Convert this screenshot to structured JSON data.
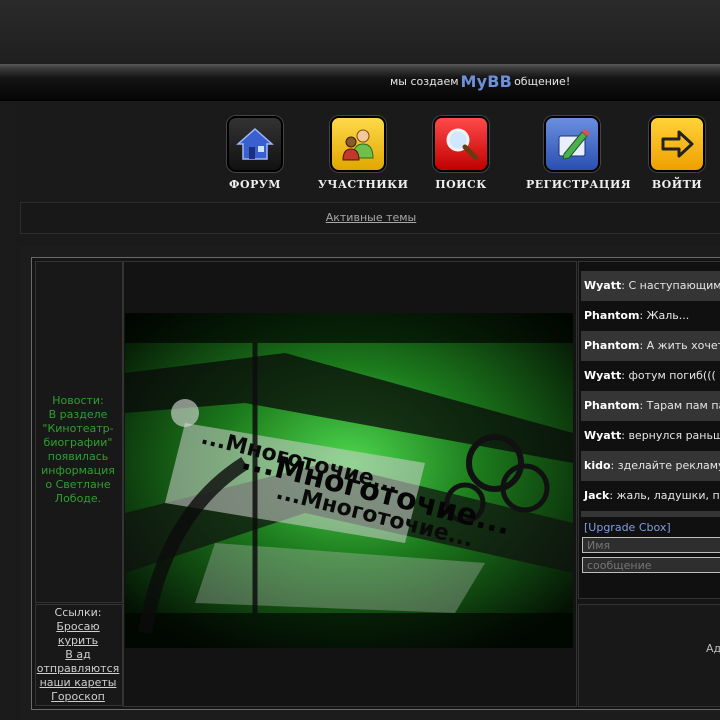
{
  "header": {
    "slogan_before": "мы создаем",
    "brand": "MyBB",
    "slogan_after": "общение!"
  },
  "nav": [
    {
      "label": "ФОРУМ",
      "icon": "home-icon"
    },
    {
      "label": "УЧАСТНИКИ",
      "icon": "users-icon"
    },
    {
      "label": "ПОИСК",
      "icon": "search-icon"
    },
    {
      "label": "РЕГИСТРАЦИЯ",
      "icon": "pencil-icon"
    },
    {
      "label": "ВОЙТИ",
      "icon": "login-arrow-icon"
    }
  ],
  "active_topics": "Активные темы",
  "news": {
    "title": "Новости:",
    "text": "В разделе \"Кинотеатр-биографии\" появилась информация о Светлане Лободе."
  },
  "links": {
    "title": "Ссылки:",
    "items": [
      "Бросаю курить",
      "В ад отправляются наши кареты",
      "Гороскоп"
    ]
  },
  "poster": {
    "text_lines": [
      "...Многоточие...",
      "...Многоточие...",
      "...Многоточие..."
    ]
  },
  "cbox": {
    "messages": [
      {
        "user": "Wyatt",
        "text": ": С наступающим"
      },
      {
        "user": "Phantom",
        "text": ": Жаль..."
      },
      {
        "user": "Phantom",
        "text": ": А жить хочет"
      },
      {
        "user": "Wyatt",
        "text": ": фотум погиб((("
      },
      {
        "user": "Phantom",
        "text": ": Тарам пам па"
      },
      {
        "user": "Wyatt",
        "text": ": вернулся раньш"
      },
      {
        "user": "kido",
        "text": ": зделайте рекламу"
      },
      {
        "user": "Jack",
        "text": ": жаль, ладушки, п"
      }
    ],
    "upgrade": "[Upgrade Cbox]",
    "name_placeholder": "Имя",
    "message_placeholder": "сообщение"
  },
  "ad_text": "Ад",
  "colors": {
    "news_green": "#2f9f2f",
    "brand_blue": "#6f8fd8",
    "upgrade_blue": "#7f9fe0"
  }
}
